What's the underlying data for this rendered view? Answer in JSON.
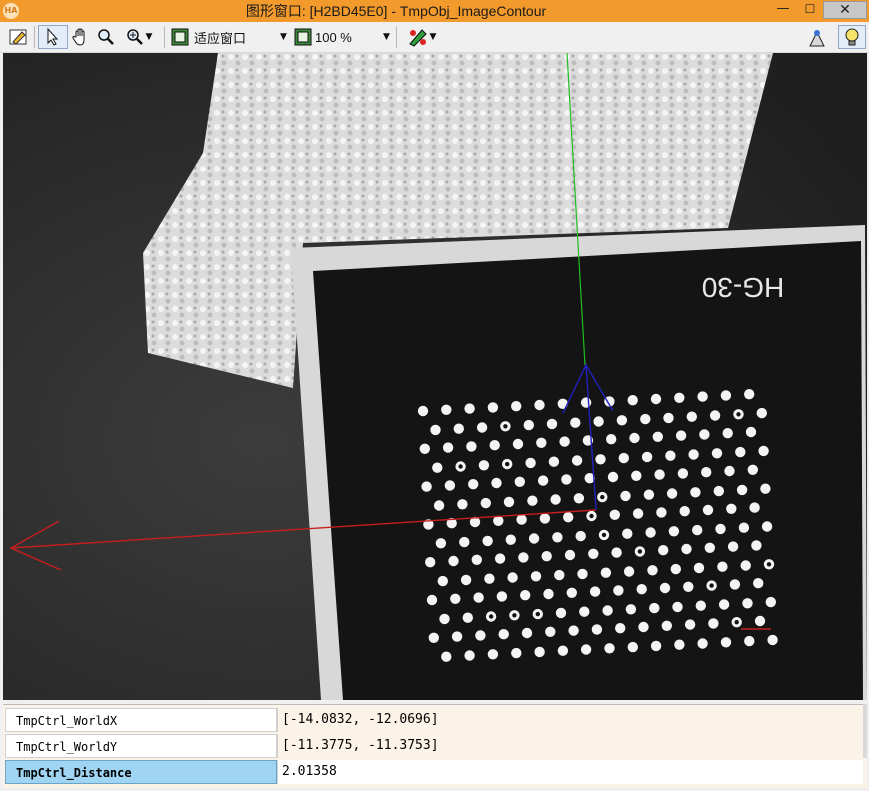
{
  "window": {
    "title": "图形窗口: [H2BD45E0] - TmpObj_ImageContour",
    "min_label": "—",
    "max_label": "☐",
    "close_label": "✕"
  },
  "toolbar": {
    "fit_label": "适应窗口",
    "zoom_label": "100 %"
  },
  "image": {
    "overlay_text": "HG-30"
  },
  "properties": [
    {
      "name": "TmpCtrl_WorldX",
      "value": "[-14.0832, -12.0696]"
    },
    {
      "name": "TmpCtrl_WorldY",
      "value": "[-11.3775, -11.3753]"
    },
    {
      "name": "TmpCtrl_Distance",
      "value": "2.01358"
    }
  ],
  "colors": {
    "titlebar": "#f39a2c",
    "x_axis": "#c81e1e",
    "y_axis": "#20c020",
    "z_axis": "#2020c0",
    "selected_row": "#9fd4f2"
  }
}
